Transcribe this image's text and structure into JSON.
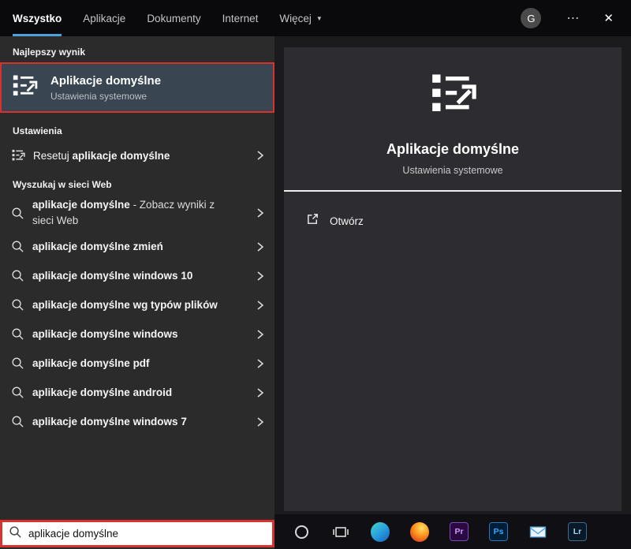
{
  "header": {
    "tabs": [
      {
        "label": "Wszystko"
      },
      {
        "label": "Aplikacje"
      },
      {
        "label": "Dokumenty"
      },
      {
        "label": "Internet"
      },
      {
        "label": "Więcej"
      }
    ],
    "dropdown_icon": "▼",
    "avatar_initial": "G",
    "more_icon": "⋯",
    "close_icon": "✕"
  },
  "results": {
    "best_match_header": "Najlepszy wynik",
    "best_match": {
      "title": "Aplikacje domyślne",
      "subtitle": "Ustawienia systemowe"
    },
    "settings_header": "Ustawienia",
    "settings_item": {
      "prefix": "Resetuj ",
      "query": "aplikacje domyślne"
    },
    "web_header": "Wyszukaj w sieci Web",
    "web_items": [
      {
        "query": "aplikacje domyślne",
        "suffix": " - Zobacz wyniki z sieci Web"
      },
      {
        "query": "aplikacje domyślne",
        "suffix": " zmień"
      },
      {
        "query": "aplikacje domyślne",
        "suffix": " windows 10"
      },
      {
        "query": "aplikacje domyślne",
        "suffix": " wg typów plików"
      },
      {
        "query": "aplikacje domyślne",
        "suffix": " windows"
      },
      {
        "query": "aplikacje domyślne",
        "suffix": " pdf"
      },
      {
        "query": "aplikacje domyślne",
        "suffix": " android"
      },
      {
        "query": "aplikacje domyślne",
        "suffix": " windows 7"
      }
    ]
  },
  "search": {
    "value": "aplikacje domyślne"
  },
  "preview": {
    "title": "Aplikacje domyślne",
    "subtitle": "Ustawienia systemowe",
    "open_label": "Otwórz"
  },
  "taskbar": {
    "premiere_label": "Pr",
    "photoshop_label": "Ps",
    "lightroom_label": "Lr"
  }
}
